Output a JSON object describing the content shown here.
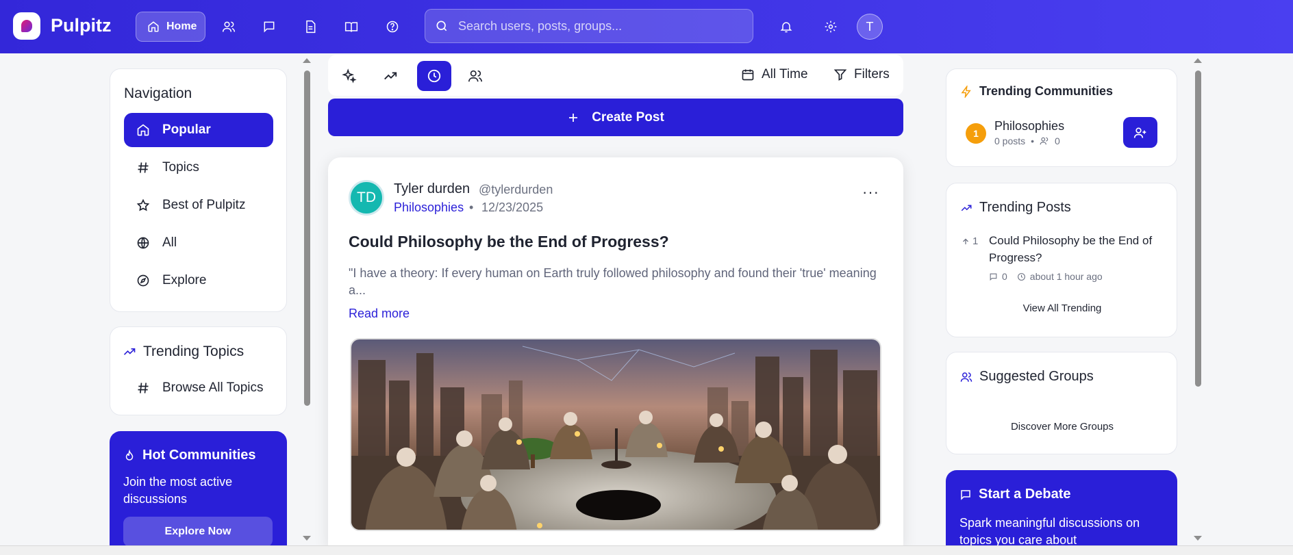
{
  "header": {
    "brand": "Pulpitz",
    "home_label": "Home",
    "search_placeholder": "Search users, posts, groups...",
    "avatar_initial": "T",
    "nav_icons": [
      "users-icon",
      "message-icon",
      "document-icon",
      "book-icon",
      "help-icon"
    ],
    "right_icons": [
      "bell-icon",
      "gear-icon"
    ]
  },
  "sidebar": {
    "title": "Navigation",
    "items": [
      {
        "label": "Popular",
        "icon": "home-icon",
        "active": true
      },
      {
        "label": "Topics",
        "icon": "hash-icon"
      },
      {
        "label": "Best of Pulpitz",
        "icon": "star-icon"
      },
      {
        "label": "All",
        "icon": "globe-icon"
      },
      {
        "label": "Explore",
        "icon": "compass-icon"
      }
    ],
    "trending_title": "Trending Topics",
    "browse_label": "Browse All Topics",
    "hot": {
      "title": "Hot Communities",
      "desc": "Join the most active discussions",
      "button": "Explore Now"
    }
  },
  "feed": {
    "toolbar": {
      "sort_icons": [
        "sparkles-icon",
        "trending-icon",
        "clock-icon",
        "users-icon"
      ],
      "active_sort": "clock-icon",
      "time_label": "All Time",
      "filters_label": "Filters"
    },
    "create_label": "Create Post",
    "post": {
      "avatar": "TD",
      "author": "Tyler durden",
      "handle": "@tylerdurden",
      "community": "Philosophies",
      "separator": "•",
      "date": "12/23/2025",
      "more": "···",
      "title": "Could Philosophy be the End of Progress?",
      "excerpt": "\"I have a theory: If every human on Earth truly followed philosophy and found their 'true' meaning a...",
      "read_more": "Read more"
    }
  },
  "right": {
    "communities": {
      "title": "Trending Communities",
      "rank": "1",
      "name": "Philosophies",
      "posts": "0 posts",
      "sep": "•",
      "members": "0"
    },
    "trending_posts": {
      "title": "Trending Posts",
      "score": "1",
      "post_title": "Could Philosophy be the End of Progress?",
      "comments": "0",
      "time": "about 1 hour ago",
      "view_all": "View All Trending"
    },
    "groups": {
      "title": "Suggested Groups",
      "discover": "Discover More Groups"
    },
    "debate": {
      "title": "Start a Debate",
      "desc": "Spark meaningful discussions on topics you care about"
    }
  },
  "colors": {
    "primary": "#2a1fd8",
    "header": "#3a2fe3",
    "teal_avatar": "#14b8b0",
    "orange_rank": "#f59e0b"
  }
}
